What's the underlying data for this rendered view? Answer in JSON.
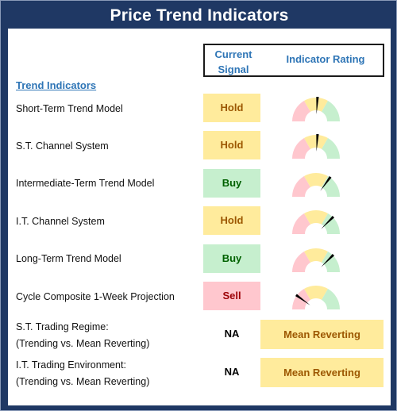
{
  "title": "Price Trend Indicators",
  "header": {
    "signal_line1": "Current",
    "signal_line2": "Signal",
    "rating": "Indicator Rating"
  },
  "section_title": "Trend Indicators",
  "colors": {
    "frame": "#1f3864",
    "header_text": "#2e75b6",
    "hold_bg": "#ffeb9c",
    "hold_text": "#9c5700",
    "buy_bg": "#c6efce",
    "buy_text": "#006100",
    "sell_bg": "#ffc7ce",
    "sell_text": "#9c0006",
    "gauge_red": "#ffc7ce",
    "gauge_yellow": "#ffeb9c",
    "gauge_green": "#c6efce",
    "needle": "#000000"
  },
  "indicators": [
    {
      "label": "Short-Term Trend Model",
      "signal": "Hold",
      "gauge_value": 0.52
    },
    {
      "label": "S.T. Channel System",
      "signal": "Hold",
      "gauge_value": 0.52
    },
    {
      "label": "Intermediate-Term Trend Model",
      "signal": "Buy",
      "gauge_value": 0.7
    },
    {
      "label": "I.T. Channel System",
      "signal": "Hold",
      "gauge_value": 0.75
    },
    {
      "label": "Long-Term Trend Model",
      "signal": "Buy",
      "gauge_value": 0.75
    },
    {
      "label": "Cycle Composite 1-Week Projection",
      "signal": "Sell",
      "gauge_value": 0.2
    }
  ],
  "regimes": [
    {
      "label_line1": "S.T. Trading Regime:",
      "label_line2": "(Trending vs. Mean Reverting)",
      "signal": "NA",
      "rating": "Mean Reverting"
    },
    {
      "label_line1": "I.T. Trading Environment:",
      "label_line2": "(Trending vs. Mean Reverting)",
      "signal": "NA",
      "rating": "Mean Reverting"
    }
  ]
}
